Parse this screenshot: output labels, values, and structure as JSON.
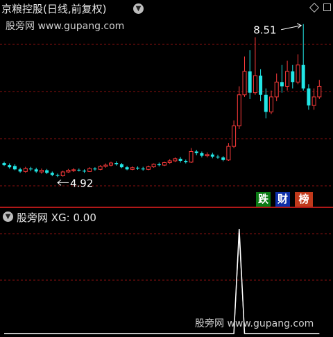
{
  "header": {
    "title": "京粮控股(日线,前复权)",
    "watermark": "股旁网 www.gupang.com"
  },
  "indicator": {
    "label": "股旁网 XG: 0.00",
    "watermark": "股旁网 www.gupang.com"
  },
  "badges": {
    "die": "跌",
    "cai": "财",
    "bang": "榜"
  },
  "colors": {
    "up": "#ff3b3b",
    "down": "#22e6e6",
    "grid": "#8b1010",
    "signal": "#ffffff",
    "separator": "#b01818"
  },
  "chart_data": [
    {
      "type": "candlestick",
      "title": "京粮控股(日线,前复权)",
      "high_annotation": "8.51",
      "low_annotation": "4.92",
      "ohlc": [
        [
          5.25,
          5.2,
          5.28,
          5.18
        ],
        [
          5.2,
          5.15,
          5.24,
          5.12
        ],
        [
          5.18,
          5.1,
          5.22,
          5.08
        ],
        [
          5.1,
          5.05,
          5.14,
          5.02
        ],
        [
          5.05,
          5.12,
          5.16,
          5.02
        ],
        [
          5.12,
          5.1,
          5.16,
          5.06
        ],
        [
          5.1,
          5.05,
          5.14,
          5.02
        ],
        [
          5.04,
          5.08,
          5.12,
          5.0
        ],
        [
          5.08,
          5.02,
          5.11,
          4.99
        ],
        [
          5.02,
          4.97,
          5.05,
          4.94
        ],
        [
          4.97,
          4.95,
          5.0,
          4.92
        ],
        [
          4.95,
          5.04,
          5.07,
          4.93
        ],
        [
          5.04,
          5.08,
          5.11,
          5.02
        ],
        [
          5.07,
          5.09,
          5.13,
          5.04
        ],
        [
          5.09,
          5.08,
          5.12,
          5.05
        ],
        [
          5.07,
          5.05,
          5.1,
          5.02
        ],
        [
          5.05,
          5.12,
          5.15,
          5.04
        ],
        [
          5.12,
          5.1,
          5.15,
          5.07
        ],
        [
          5.1,
          5.17,
          5.2,
          5.08
        ],
        [
          5.17,
          5.2,
          5.24,
          5.14
        ],
        [
          5.2,
          5.25,
          5.28,
          5.17
        ],
        [
          5.25,
          5.22,
          5.29,
          5.19
        ],
        [
          5.22,
          5.15,
          5.25,
          5.13
        ],
        [
          5.15,
          5.1,
          5.18,
          5.08
        ],
        [
          5.1,
          5.14,
          5.17,
          5.08
        ],
        [
          5.14,
          5.12,
          5.17,
          5.09
        ],
        [
          5.12,
          5.1,
          5.16,
          5.07
        ],
        [
          5.1,
          5.16,
          5.19,
          5.08
        ],
        [
          5.16,
          5.22,
          5.24,
          5.14
        ],
        [
          5.22,
          5.2,
          5.26,
          5.17
        ],
        [
          5.2,
          5.26,
          5.28,
          5.18
        ],
        [
          5.26,
          5.3,
          5.34,
          5.23
        ],
        [
          5.3,
          5.35,
          5.38,
          5.27
        ],
        [
          5.35,
          5.3,
          5.39,
          5.26
        ],
        [
          5.3,
          5.27,
          5.33,
          5.24
        ],
        [
          5.27,
          5.52,
          5.6,
          5.25
        ],
        [
          5.52,
          5.48,
          5.56,
          5.43
        ],
        [
          5.48,
          5.42,
          5.52,
          5.38
        ],
        [
          5.42,
          5.45,
          5.5,
          5.38
        ],
        [
          5.45,
          5.4,
          5.49,
          5.36
        ],
        [
          5.4,
          5.38,
          5.44,
          5.35
        ],
        [
          5.38,
          5.32,
          5.41,
          5.29
        ],
        [
          5.32,
          5.64,
          5.72,
          5.3
        ],
        [
          5.64,
          6.12,
          6.25,
          5.6
        ],
        [
          6.12,
          6.85,
          7.05,
          6.05
        ],
        [
          6.85,
          7.4,
          7.75,
          6.8
        ],
        [
          7.4,
          6.9,
          7.9,
          6.75
        ],
        [
          6.9,
          7.3,
          8.2,
          6.85
        ],
        [
          7.3,
          6.85,
          7.45,
          6.7
        ],
        [
          6.85,
          6.45,
          7.0,
          6.3
        ],
        [
          6.45,
          6.8,
          6.95,
          6.4
        ],
        [
          6.8,
          7.15,
          7.35,
          6.7
        ],
        [
          7.15,
          7.05,
          7.55,
          6.9
        ],
        [
          7.05,
          7.4,
          7.65,
          6.95
        ],
        [
          7.4,
          7.15,
          7.55,
          7.0
        ],
        [
          7.15,
          7.55,
          7.8,
          7.1
        ],
        [
          7.55,
          7.0,
          8.51,
          6.95
        ],
        [
          7.0,
          6.6,
          7.1,
          6.5
        ],
        [
          6.6,
          6.8,
          7.0,
          6.5
        ],
        [
          6.8,
          7.05,
          7.2,
          6.75
        ]
      ]
    },
    {
      "type": "line",
      "series": [
        {
          "name": "XG",
          "values": [
            0,
            0,
            0,
            0,
            0,
            0,
            0,
            0,
            0,
            0,
            0,
            0,
            0,
            0,
            0,
            0,
            0,
            0,
            0,
            0,
            0,
            0,
            0,
            0,
            0,
            0,
            0,
            0,
            0,
            0,
            0,
            0,
            0,
            0,
            0,
            0,
            0,
            0,
            0,
            0,
            0,
            0,
            0,
            0,
            1,
            0,
            0,
            0,
            0,
            0,
            0,
            0,
            0,
            0,
            0,
            0,
            0,
            0,
            0,
            0
          ]
        }
      ],
      "ylim": [
        0,
        1
      ]
    }
  ]
}
